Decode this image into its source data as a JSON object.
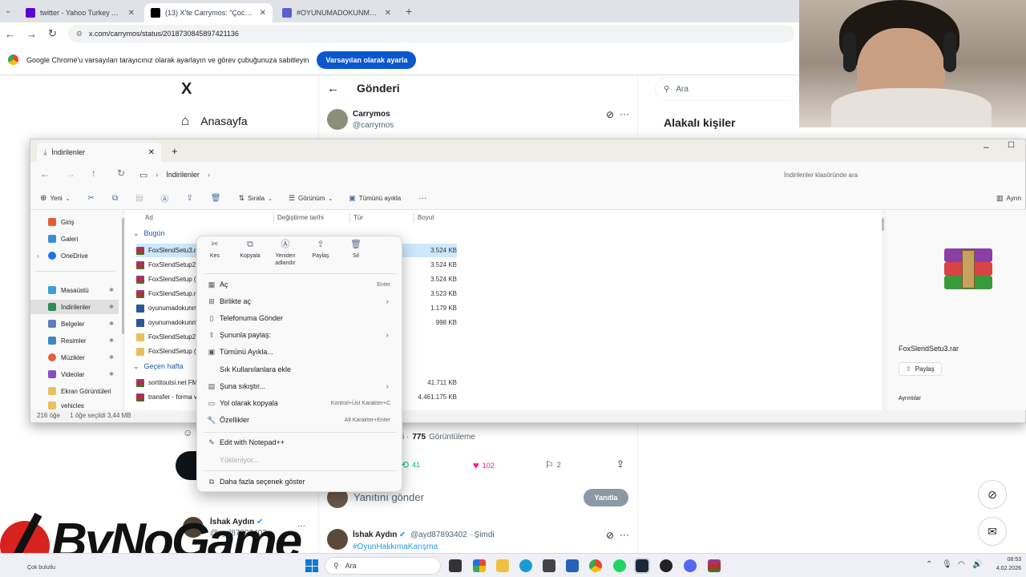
{
  "browser": {
    "tabs": [
      {
        "title": "twitter - Yahoo Turkey Arama S",
        "color": "#6001d2"
      },
      {
        "title": "(13) X'te Carrymos: \"Çocuklar b",
        "color": "#000000"
      },
      {
        "title": "#OYUNUMADOKUNMA - Dijital",
        "color": "#5a5fcf"
      }
    ],
    "url": "x.com/carrymos/status/2018730845897421136",
    "infobar_text": "Google Chrome'u varsayılan tarayıcınız olarak ayarlayın ve görev çubuğunuza sabitleyin",
    "infobar_button": "Varsayılan olarak ayarla"
  },
  "x": {
    "logo": "X",
    "home": "Anasayfa",
    "header": "Gönderi",
    "author_name": "Carrymos",
    "author_handle": "@carrymos",
    "search_placeholder": "Ara",
    "related": "Alakalı kişiler",
    "views_count": "775",
    "views_label": "Görüntüleme",
    "views_prefix": "i ·",
    "retweets": "41",
    "likes": "102",
    "bookmarks": "2",
    "reply_placeholder": "Yanıtını gönder",
    "reply_button": "Yanıtla",
    "reply_name": "İshak Aydın",
    "reply_handle": "@ayd87893402 · Şimdi",
    "reply_hashtag": "#OyunHakkımaKarışma",
    "side_name": "İshak Aydın",
    "side_handle": "@ayd87893402"
  },
  "explorer": {
    "tab_title": "İndirilenler",
    "breadcrumb": "İndirilenler",
    "search_placeholder": "İndirilenler klasöründe ara",
    "toolbar": {
      "new": "Yeni",
      "sort": "Sırala",
      "view": "Görünüm",
      "extract_all": "Tümünü ayıkla",
      "more": "Ayrın"
    },
    "sidebar": [
      {
        "label": "Giriş",
        "color": "#e25d33"
      },
      {
        "label": "Galeri",
        "color": "#3b8ed0"
      },
      {
        "label": "OneDrive",
        "color": "#1a73e8"
      },
      {
        "label": "Masaüstü",
        "color": "#3aa0d8"
      },
      {
        "label": "İndirilenler",
        "color": "#2e8b57"
      },
      {
        "label": "Belgeler",
        "color": "#5b7fbf"
      },
      {
        "label": "Resimler",
        "color": "#3b88c3"
      },
      {
        "label": "Müzikler",
        "color": "#e0603a"
      },
      {
        "label": "Videolar",
        "color": "#8a4fbf"
      },
      {
        "label": "Ekran Görüntüleri",
        "color": "#e8c15a"
      },
      {
        "label": "vehicles",
        "color": "#e8c15a"
      }
    ],
    "columns": {
      "name": "Ad",
      "modified": "Değiştirme tarihi",
      "type": "Tür",
      "size": "Boyut"
    },
    "groups": {
      "today": "Bugün",
      "last_week": "Geçen hafta"
    },
    "files_today": [
      {
        "name": "FoxSlendSetu3.rar",
        "size": "3.524 KB",
        "kind": "rar"
      },
      {
        "name": "FoxSlendSetup2.ra",
        "size": "3.524 KB",
        "kind": "rar"
      },
      {
        "name": "FoxSlendSetup (1",
        "size": "3.524 KB",
        "kind": "rar"
      },
      {
        "name": "FoxSlendSetup.ra",
        "size": "3.523 KB",
        "kind": "rar"
      },
      {
        "name": "oyunumadokunm",
        "size": "1.179 KB",
        "kind": "doc"
      },
      {
        "name": "oyunumadokunm",
        "size": "998 KB",
        "kind": "doc"
      },
      {
        "name": "FoxSlendSetup2",
        "size": "",
        "kind": "folder"
      },
      {
        "name": "FoxSlendSetup (1",
        "size": "",
        "kind": "folder"
      }
    ],
    "files_week": [
      {
        "name": "sortitoutsi.net FM",
        "size": "41.711 KB",
        "kind": "rar"
      },
      {
        "name": "transfer - forma v",
        "size": "4.461.175 KB",
        "kind": "rar"
      }
    ],
    "status_count": "216 öğe",
    "status_selected": "1 öğe seçildi 3,44 MB",
    "detail_filename": "FoxSlendSetu3.rar",
    "detail_share": "Paylaş",
    "detail_details": "Ayrıntılar"
  },
  "context_menu": {
    "top": [
      {
        "icon": "✂",
        "label": "Kes"
      },
      {
        "icon": "⧉",
        "label": "Kopyala"
      },
      {
        "icon": "Ⓐ",
        "label": "Yeniden adlandır"
      },
      {
        "icon": "⇪",
        "label": "Paylaş"
      },
      {
        "icon": "🗑",
        "label": "Sil"
      }
    ],
    "items": [
      {
        "label": "Aç",
        "shortcut": "Enter",
        "arrow": ""
      },
      {
        "label": "Birlikte aç",
        "shortcut": "",
        "arrow": "›"
      },
      {
        "label": "Telefonuma Gönder",
        "shortcut": "",
        "arrow": ""
      },
      {
        "label": "Şununla paylaş:",
        "shortcut": "",
        "arrow": "›"
      },
      {
        "label": "Tümünü Ayıkla...",
        "shortcut": "",
        "arrow": ""
      },
      {
        "label": "Sık Kullanılanlara ekle",
        "shortcut": "",
        "arrow": ""
      },
      {
        "label": "Şuna sıkıştır...",
        "shortcut": "",
        "arrow": "›"
      },
      {
        "label": "Yol olarak kopyala",
        "shortcut": "Kontrol+Üst Karakter+C",
        "arrow": ""
      },
      {
        "label": "Özellikler",
        "shortcut": "Alt Karakter+Enter",
        "arrow": ""
      }
    ],
    "notepad": "Edit with Notepad++",
    "loading": "Yükleniyor...",
    "more": "Daha fazla seçenek göster"
  },
  "taskbar": {
    "search": "Ara",
    "time": "08:53",
    "date": "4.02.2026",
    "weather": "Çok bulutlu"
  },
  "watermark": "ByNoGame"
}
